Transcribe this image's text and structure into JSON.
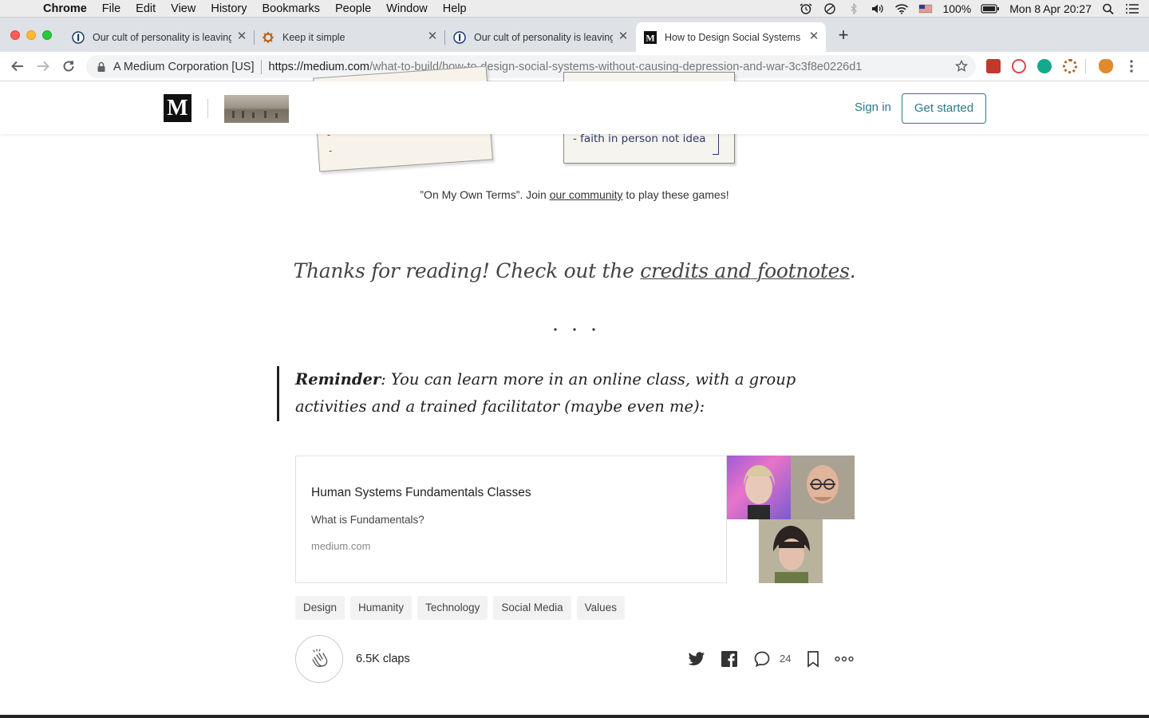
{
  "menubar": {
    "app": "Chrome",
    "items": [
      "File",
      "Edit",
      "View",
      "History",
      "Bookmarks",
      "People",
      "Window",
      "Help"
    ],
    "battery": "100%",
    "datetime": "Mon 8 Apr  20:27"
  },
  "tabs": [
    {
      "title": "Our cult of personality is leaving",
      "icon": "opinion-site-icon",
      "active": false
    },
    {
      "title": "Keep it simple",
      "icon": "wheel-icon",
      "active": false
    },
    {
      "title": "Our cult of personality is leaving",
      "icon": "opinion-site-icon",
      "active": false
    },
    {
      "title": "How to Design Social Systems (",
      "icon": "medium-icon",
      "active": true
    }
  ],
  "omnibox": {
    "cert": "A Medium Corporation [US]",
    "url_host": "https://medium.com",
    "url_path": "/what-to-build/how-to-design-social-systems-without-causing-depression-and-war-3c3f8e0226d1"
  },
  "nav": {
    "logo": "M",
    "sign_in": "Sign in",
    "get_started": "Get started"
  },
  "illustration": {
    "line": "- faith in person not idea"
  },
  "article": {
    "caption_before": "”On My Own Terms”. Join ",
    "caption_link": "our community",
    "caption_after": " to play these games!",
    "thanks_before": "Thanks for reading! Check out the ",
    "thanks_link": "credits and footnotes",
    "thanks_after": ".",
    "separator": "...",
    "reminder_label": "Reminder",
    "reminder_text": ": You can learn more in an online class, with a group activities and a trained facilitator (maybe even me):"
  },
  "embed": {
    "title": "Human Systems Fundamentals Classes",
    "description": "What is Fundamentals?",
    "host": "medium.com"
  },
  "tags": [
    "Design",
    "Humanity",
    "Technology",
    "Social Media",
    "Values"
  ],
  "footer": {
    "claps": "6.5K claps",
    "responses": "24"
  },
  "colors": {
    "accent": "#2b7a88"
  }
}
